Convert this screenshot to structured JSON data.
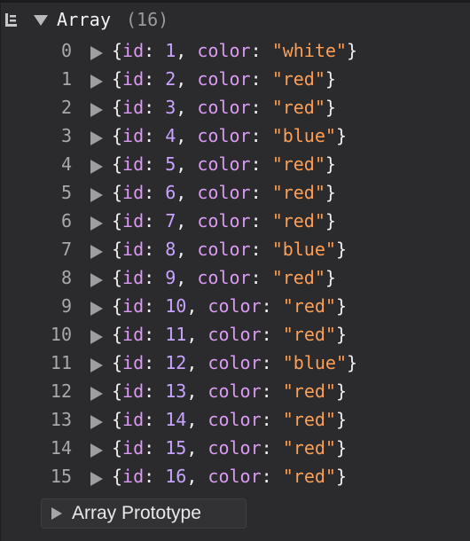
{
  "header": {
    "title": "Array",
    "count": "(16)",
    "icon": "log-level-icon"
  },
  "items": [
    {
      "index": "0",
      "id": "1",
      "color": "\"white\""
    },
    {
      "index": "1",
      "id": "2",
      "color": "\"red\""
    },
    {
      "index": "2",
      "id": "3",
      "color": "\"red\""
    },
    {
      "index": "3",
      "id": "4",
      "color": "\"blue\""
    },
    {
      "index": "4",
      "id": "5",
      "color": "\"red\""
    },
    {
      "index": "5",
      "id": "6",
      "color": "\"red\""
    },
    {
      "index": "6",
      "id": "7",
      "color": "\"red\""
    },
    {
      "index": "7",
      "id": "8",
      "color": "\"blue\""
    },
    {
      "index": "8",
      "id": "9",
      "color": "\"red\""
    },
    {
      "index": "9",
      "id": "10",
      "color": "\"red\""
    },
    {
      "index": "10",
      "id": "11",
      "color": "\"red\""
    },
    {
      "index": "11",
      "id": "12",
      "color": "\"blue\""
    },
    {
      "index": "12",
      "id": "13",
      "color": "\"red\""
    },
    {
      "index": "13",
      "id": "14",
      "color": "\"red\""
    },
    {
      "index": "14",
      "id": "15",
      "color": "\"red\""
    },
    {
      "index": "15",
      "id": "16",
      "color": "\"red\""
    }
  ],
  "syntax": {
    "open_brace": "{",
    "close_brace": "}",
    "id_key": "id",
    "color_key": "color",
    "colon": ": ",
    "comma": ", "
  },
  "prototype": {
    "label": "Array Prototype"
  },
  "colors": {
    "background": "#2b2b2d",
    "key": "#d99cf2",
    "number": "#c7a4ff",
    "string": "#fc9f57",
    "index": "#a8a8ad"
  }
}
